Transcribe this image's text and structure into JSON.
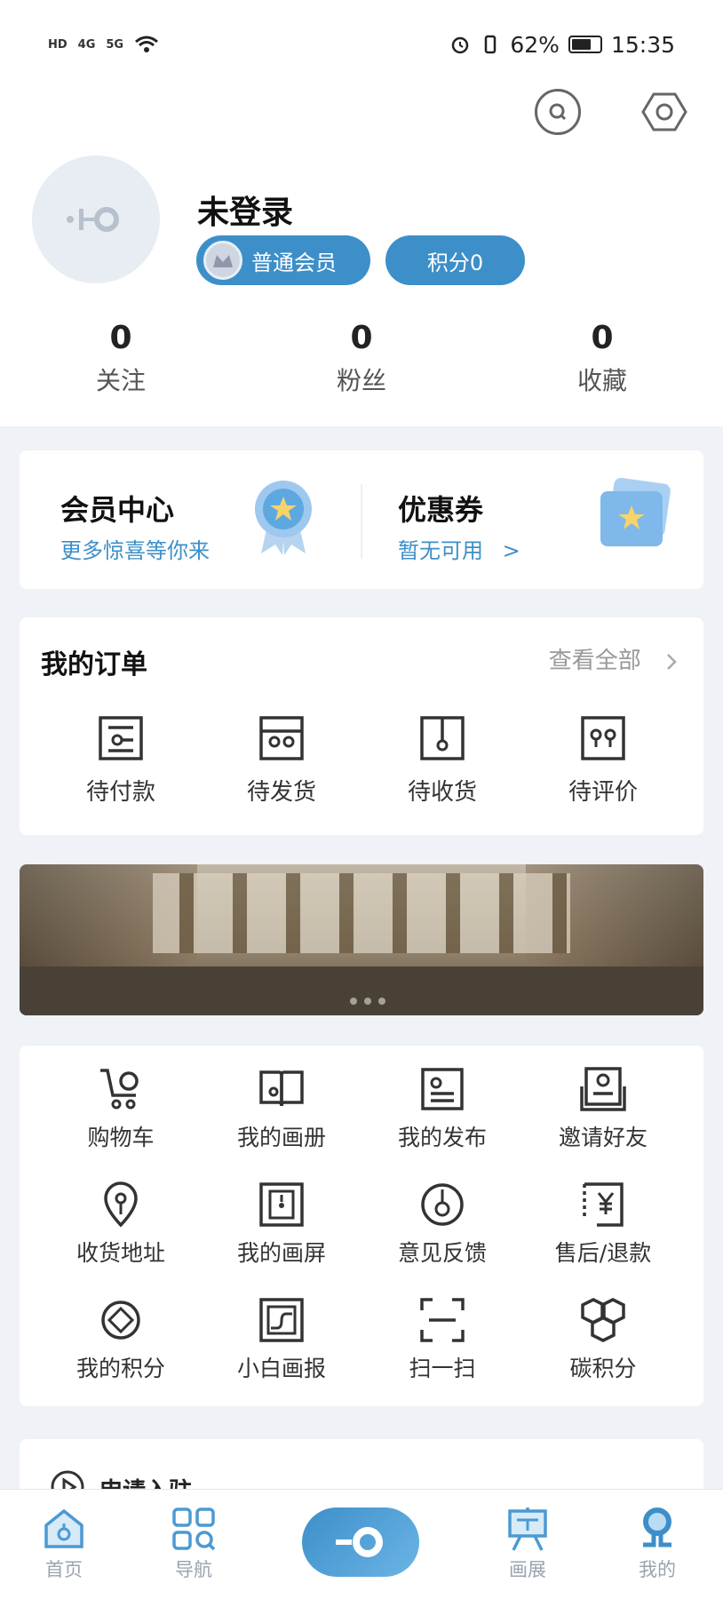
{
  "status_bar": {
    "left_indicators": [
      "HD",
      "4G",
      "5G"
    ],
    "battery": "62%",
    "time": "15:35"
  },
  "header": {
    "username": "未登录",
    "member_level": "普通会员",
    "points_label": "积分0"
  },
  "stats": [
    {
      "value": "0",
      "label": "关注"
    },
    {
      "value": "0",
      "label": "粉丝"
    },
    {
      "value": "0",
      "label": "收藏"
    }
  ],
  "vip": {
    "member_center_title": "会员中心",
    "member_center_sub": "更多惊喜等你来",
    "coupon_title": "优惠券",
    "coupon_sub": "暂无可用",
    "coupon_arrow": ">"
  },
  "orders": {
    "title": "我的订单",
    "view_all": "查看全部",
    "items": [
      {
        "label": "待付款"
      },
      {
        "label": "待发货"
      },
      {
        "label": "待收货"
      },
      {
        "label": "待评价"
      }
    ]
  },
  "tools": [
    {
      "label": "购物车",
      "icon": "cart-icon"
    },
    {
      "label": "我的画册",
      "icon": "book-icon"
    },
    {
      "label": "我的发布",
      "icon": "publish-icon"
    },
    {
      "label": "邀请好友",
      "icon": "invite-icon"
    },
    {
      "label": "收货地址",
      "icon": "location-icon"
    },
    {
      "label": "我的画屏",
      "icon": "screen-icon"
    },
    {
      "label": "意见反馈",
      "icon": "feedback-icon"
    },
    {
      "label": "售后/退款",
      "icon": "refund-icon"
    },
    {
      "label": "我的积分",
      "icon": "points-icon"
    },
    {
      "label": "小白画报",
      "icon": "pictorial-icon"
    },
    {
      "label": "扫一扫",
      "icon": "scan-icon"
    },
    {
      "label": "碳积分",
      "icon": "carbon-icon"
    }
  ],
  "apply": {
    "label": "申请入驻"
  },
  "tabbar": {
    "home": "首页",
    "nav": "导航",
    "exhibition": "画展",
    "mine": "我的"
  },
  "colors": {
    "accent": "#3d8fc9",
    "background": "#eff2f6"
  }
}
